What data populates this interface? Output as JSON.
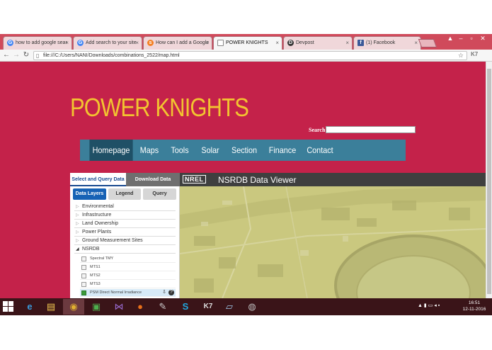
{
  "browser": {
    "tabs": [
      {
        "label": "how to add google sear",
        "favicon": "google-icon",
        "color": "#4285f4"
      },
      {
        "label": "Add search to your site",
        "favicon": "google-icon",
        "color": "#4285f4"
      },
      {
        "label": "How can I add a Google",
        "favicon": "stackoverflow-icon",
        "color": "#f48024"
      },
      {
        "label": "POWER KNIGHTS",
        "favicon": "page-icon",
        "color": "#777777",
        "active": true
      },
      {
        "label": "Devpost",
        "favicon": "devpost-icon",
        "color": "#333333"
      },
      {
        "label": "(1) Facebook",
        "favicon": "facebook-icon",
        "color": "#3b5998"
      }
    ],
    "url": "file:///C:/Users/NANI/Downloads/combinations_2522/map.html",
    "extension_label": "K7"
  },
  "site": {
    "title": "POWER KNIGHTS",
    "search_label": "Search",
    "search_value": "",
    "nav": [
      {
        "label": "Homepage",
        "active": true
      },
      {
        "label": "Maps"
      },
      {
        "label": "Tools"
      },
      {
        "label": "Solar"
      },
      {
        "label": "Section"
      },
      {
        "label": "Finance"
      },
      {
        "label": "Contact"
      }
    ],
    "colors": {
      "background": "#c4224a",
      "title": "#f2c430",
      "nav": "#3b7f9a",
      "nav_active": "#1f5066"
    }
  },
  "viewer": {
    "logo": "NREL",
    "title": "NSRDB Data Viewer",
    "tabs": {
      "query": "Select and Query Data",
      "download": "Download Data"
    },
    "subtabs": {
      "layers": "Data Layers",
      "legend": "Legend",
      "query": "Query"
    },
    "layers": [
      {
        "label": "Environmental",
        "expanded": false
      },
      {
        "label": "Infrastructure",
        "expanded": false
      },
      {
        "label": "Land Ownership",
        "expanded": false
      },
      {
        "label": "Power Plants",
        "expanded": false
      },
      {
        "label": "Ground Measurement Sites",
        "expanded": false
      },
      {
        "label": "NSRDB",
        "expanded": true
      }
    ],
    "nsrdb_sublayers": [
      {
        "label": "Spectral TMY",
        "checked": false
      },
      {
        "label": "MTS1",
        "checked": false
      },
      {
        "label": "MTS2",
        "checked": false
      },
      {
        "label": "MTS3",
        "checked": false
      },
      {
        "label": "PSM Direct Normal Irradiance",
        "checked": true
      }
    ]
  },
  "taskbar": {
    "apps": [
      "ie-icon",
      "file-explorer-icon",
      "chrome-icon",
      "store-icon",
      "visual-studio-icon",
      "firefox-icon",
      "paint-icon",
      "skype-icon",
      "k7-icon",
      "notepad-icon",
      "chrome-alt-icon"
    ],
    "clock_time": "16:51",
    "clock_date": "12-11-2016"
  }
}
